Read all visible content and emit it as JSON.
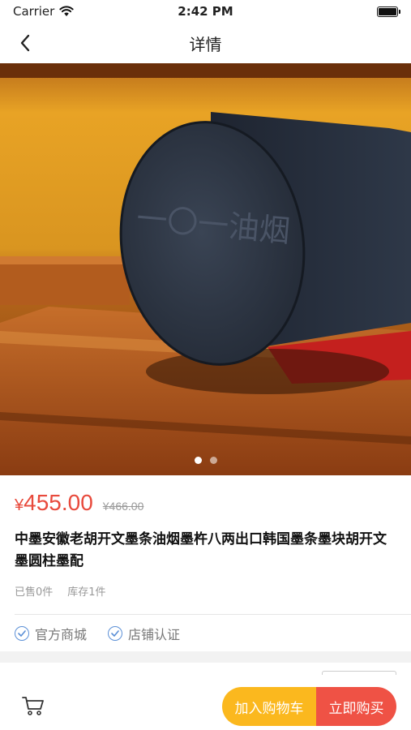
{
  "status_bar": {
    "carrier": "Carrier",
    "time": "2:42 PM",
    "battery_level": 1.0
  },
  "nav": {
    "title": "详情",
    "back_icon": "chevron-left-icon"
  },
  "product": {
    "image_text": "一〇一油烟",
    "carousel": {
      "total": 2,
      "active_index": 0
    },
    "price_symbol": "¥",
    "price": "455.00",
    "original_price": "¥466.00",
    "title": "中墨安徽老胡开文墨条油烟墨杵八两出口韩国墨条墨块胡开文墨圆柱墨配",
    "sold": "已售0件",
    "stock": "库存1件",
    "badges": [
      {
        "label": "官方商城",
        "icon": "check-circle-icon"
      },
      {
        "label": "店铺认证",
        "icon": "check-circle-icon"
      }
    ]
  },
  "bottom_bar": {
    "cart_icon": "shopping-cart-icon",
    "add_to_cart_label": "加入购物车",
    "buy_now_label": "立即购买"
  },
  "colors": {
    "price": "#e84a3c",
    "add_to_cart": "#fbb81e",
    "buy_now": "#ef5245",
    "badge_check": "#5b8fd6"
  }
}
